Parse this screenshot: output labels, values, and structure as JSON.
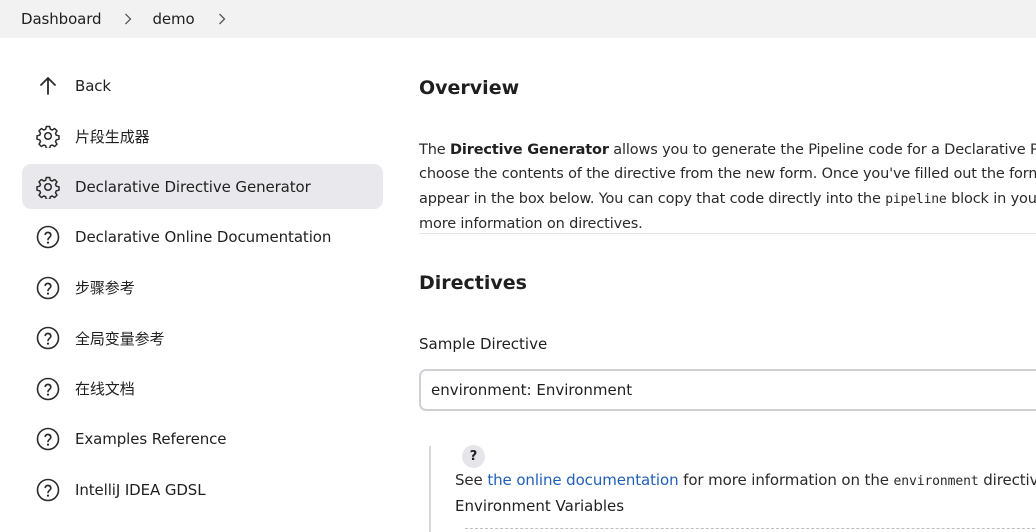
{
  "breadcrumb": {
    "items": [
      "Dashboard",
      "demo"
    ]
  },
  "sidebar": {
    "items": [
      {
        "label": "Back",
        "icon": "arrow-up-icon"
      },
      {
        "label": "片段生成器",
        "icon": "gear-icon"
      },
      {
        "label": "Declarative Directive Generator",
        "icon": "gear-icon",
        "active": true
      },
      {
        "label": "Declarative Online Documentation",
        "icon": "help-circle-icon"
      },
      {
        "label": "步骤参考",
        "icon": "help-circle-icon"
      },
      {
        "label": "全局变量参考",
        "icon": "help-circle-icon"
      },
      {
        "label": "在线文档",
        "icon": "help-circle-icon"
      },
      {
        "label": "Examples Reference",
        "icon": "help-circle-icon"
      },
      {
        "label": "IntelliJ IDEA GDSL",
        "icon": "help-circle-icon"
      }
    ]
  },
  "main": {
    "overview_title": "Overview",
    "intro": {
      "l1_pre": "The ",
      "l1_bold": "Directive Generator",
      "l1_post": " allows you to generate the Pipeline code for a Declarative Pipeline",
      "l2": "choose the contents of the directive from the new form. Once you've filled out the form wit",
      "l3_pre": "appear in the box below. You can copy that code directly into the ",
      "l3_code": "pipeline",
      "l3_post": " block in your Je",
      "l4": "more information on directives."
    },
    "directives_title": "Directives",
    "sample_label": "Sample Directive",
    "sample_value": "environment: Environment",
    "help_badge": "?",
    "help": {
      "pre": "See ",
      "link": "the online documentation",
      "mid": " for more information on the ",
      "code": "environment",
      "post": " directive."
    },
    "env_label": "Environment Variables"
  },
  "colors": {
    "link": "#1f5fb8",
    "active_bg": "#e9e9ed",
    "breadcrumb_bg": "#f2f2f3"
  }
}
